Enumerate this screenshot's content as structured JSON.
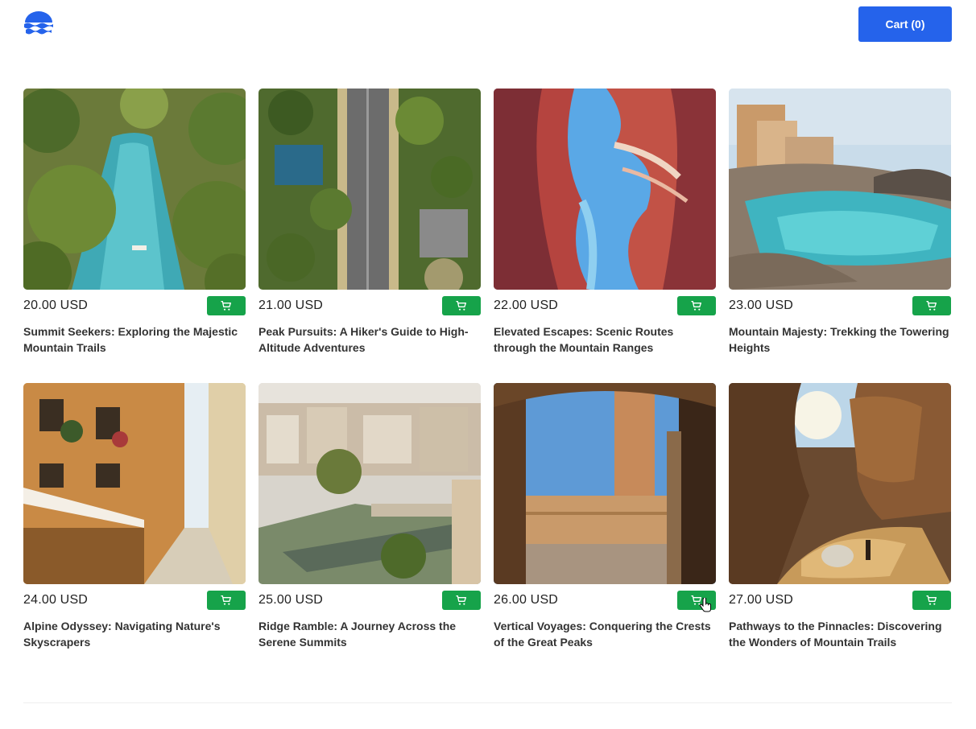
{
  "header": {
    "logo_icon": "waves-logo-icon",
    "cart_label": "Cart (0)",
    "accent_color": "#2563eb"
  },
  "products": [
    {
      "price": "20.00 USD",
      "title": "Summit Seekers: Exploring the Majestic Mountain Trails",
      "image": "tropical-river-palms"
    },
    {
      "price": "21.00 USD",
      "title": "Peak Pursuits: A Hiker's Guide to High-Altitude Adventures",
      "image": "aerial-street-trees"
    },
    {
      "price": "22.00 USD",
      "title": "Elevated Escapes: Scenic Routes through the Mountain Ranges",
      "image": "red-canyon-sky"
    },
    {
      "price": "23.00 USD",
      "title": "Mountain Majesty: Trekking the Towering Heights",
      "image": "coastal-lagoon-village"
    },
    {
      "price": "24.00 USD",
      "title": "Alpine Odyssey: Navigating Nature's Skyscrapers",
      "image": "narrow-street-balconies"
    },
    {
      "price": "25.00 USD",
      "title": "Ridge Ramble: A Journey Across the Serene Summits",
      "image": "city-river-bridge"
    },
    {
      "price": "26.00 USD",
      "title": "Vertical Voyages: Conquering the Crests of the Great Peaks",
      "image": "plaza-tower-arches"
    },
    {
      "price": "27.00 USD",
      "title": "Pathways to the Pinnacles: Discovering the Wonders of Mountain Trails",
      "image": "desert-rock-tent"
    }
  ],
  "add_to_cart_icon": "cart-icon",
  "add_button_color": "#16a34a"
}
